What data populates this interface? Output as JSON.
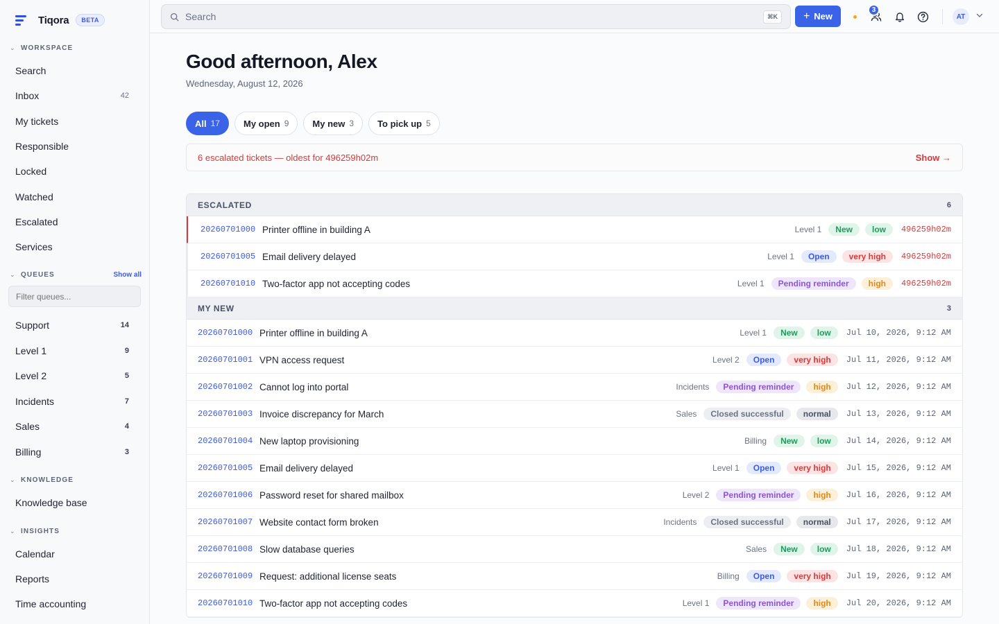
{
  "brand": {
    "name": "Tiqora",
    "badge": "BETA"
  },
  "sidebar": {
    "workspace": {
      "label": "WORKSPACE",
      "items": [
        {
          "label": "Search",
          "count": ""
        },
        {
          "label": "Inbox",
          "count": "42"
        },
        {
          "label": "My tickets",
          "count": ""
        },
        {
          "label": "Responsible",
          "count": ""
        },
        {
          "label": "Locked",
          "count": ""
        },
        {
          "label": "Watched",
          "count": ""
        },
        {
          "label": "Escalated",
          "count": ""
        },
        {
          "label": "Services",
          "count": ""
        }
      ]
    },
    "queues": {
      "label": "QUEUES",
      "action": "Show all",
      "filter_placeholder": "Filter queues...",
      "items": [
        {
          "label": "Support",
          "count": "14"
        },
        {
          "label": "Level 1",
          "count": "9"
        },
        {
          "label": "Level 2",
          "count": "5"
        },
        {
          "label": "Incidents",
          "count": "7"
        },
        {
          "label": "Sales",
          "count": "4"
        },
        {
          "label": "Billing",
          "count": "3"
        }
      ]
    },
    "knowledge": {
      "label": "KNOWLEDGE",
      "items": [
        {
          "label": "Knowledge base"
        }
      ]
    },
    "insights": {
      "label": "INSIGHTS",
      "items": [
        {
          "label": "Calendar"
        },
        {
          "label": "Reports"
        },
        {
          "label": "Time accounting"
        }
      ]
    }
  },
  "topbar": {
    "search_placeholder": "Search",
    "shortcut": "⌘K",
    "new_label": "New",
    "team_badge": "3",
    "avatar_initials": "AT"
  },
  "main": {
    "greeting": "Good afternoon, Alex",
    "date": "Wednesday, August 12, 2026",
    "tabs": [
      {
        "label": "All",
        "count": "17"
      },
      {
        "label": "My open",
        "count": "9"
      },
      {
        "label": "My new",
        "count": "3"
      },
      {
        "label": "To pick up",
        "count": "5"
      }
    ],
    "alert": {
      "text": "6 escalated tickets — oldest for 496259h02m",
      "action": "Show →"
    },
    "escalated": {
      "label": "ESCALATED",
      "count": "6",
      "rows": [
        {
          "number": "20260701000",
          "title": "Printer offline in building A",
          "group": "Level 1",
          "state": "New",
          "priority": "low",
          "time": "496259h02m"
        },
        {
          "number": "20260701005",
          "title": "Email delivery delayed",
          "group": "Level 1",
          "state": "Open",
          "priority": "very high",
          "time": "496259h02m"
        },
        {
          "number": "20260701010",
          "title": "Two-factor app not accepting codes",
          "group": "Level 1",
          "state": "Pending reminder",
          "priority": "high",
          "time": "496259h02m"
        }
      ]
    },
    "mynew": {
      "label": "MY NEW",
      "count": "3",
      "rows": [
        {
          "number": "20260701000",
          "title": "Printer offline in building A",
          "group": "Level 1",
          "state": "New",
          "priority": "low",
          "time": "Jul 10, 2026, 9:12 AM"
        },
        {
          "number": "20260701001",
          "title": "VPN access request",
          "group": "Level 2",
          "state": "Open",
          "priority": "very high",
          "time": "Jul 11, 2026, 9:12 AM"
        },
        {
          "number": "20260701002",
          "title": "Cannot log into portal",
          "group": "Incidents",
          "state": "Pending reminder",
          "priority": "high",
          "time": "Jul 12, 2026, 9:12 AM"
        },
        {
          "number": "20260701003",
          "title": "Invoice discrepancy for March",
          "group": "Sales",
          "state": "Closed successful",
          "priority": "normal",
          "time": "Jul 13, 2026, 9:12 AM"
        },
        {
          "number": "20260701004",
          "title": "New laptop provisioning",
          "group": "Billing",
          "state": "New",
          "priority": "low",
          "time": "Jul 14, 2026, 9:12 AM"
        },
        {
          "number": "20260701005",
          "title": "Email delivery delayed",
          "group": "Level 1",
          "state": "Open",
          "priority": "very high",
          "time": "Jul 15, 2026, 9:12 AM"
        },
        {
          "number": "20260701006",
          "title": "Password reset for shared mailbox",
          "group": "Level 2",
          "state": "Pending reminder",
          "priority": "high",
          "time": "Jul 16, 2026, 9:12 AM"
        },
        {
          "number": "20260701007",
          "title": "Website contact form broken",
          "group": "Incidents",
          "state": "Closed successful",
          "priority": "normal",
          "time": "Jul 17, 2026, 9:12 AM"
        },
        {
          "number": "20260701008",
          "title": "Slow database queries",
          "group": "Sales",
          "state": "New",
          "priority": "low",
          "time": "Jul 18, 2026, 9:12 AM"
        },
        {
          "number": "20260701009",
          "title": "Request: additional license seats",
          "group": "Billing",
          "state": "Open",
          "priority": "very high",
          "time": "Jul 19, 2026, 9:12 AM"
        },
        {
          "number": "20260701010",
          "title": "Two-factor app not accepting codes",
          "group": "Level 1",
          "state": "Pending reminder",
          "priority": "high",
          "time": "Jul 20, 2026, 9:12 AM"
        }
      ]
    }
  },
  "colors": {
    "accent": "#3b63e8",
    "danger": "#d83a3a",
    "state_new": "#1f9b5e",
    "state_open": "#3b5ae8",
    "state_pending": "#8a55d6",
    "priority_high": "#e0881c"
  },
  "icons": {
    "logo": "lines-logo-icon",
    "search": "search-icon",
    "team": "team-icon",
    "bell": "bell-icon",
    "help": "help-circle-icon",
    "chevron": "chevron-down-icon"
  }
}
